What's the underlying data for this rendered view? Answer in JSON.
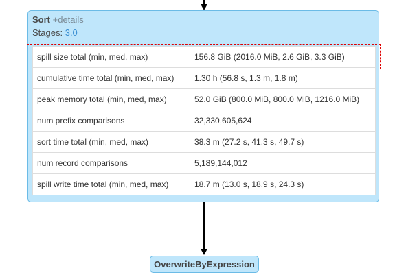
{
  "sort_node": {
    "title": "Sort",
    "details_link": "+details",
    "stages_label": "Stages:",
    "stages_value": "3.0",
    "metrics": [
      {
        "name": "spill size total (min, med, max)",
        "value": "156.8 GiB (2016.0 MiB, 2.6 GiB, 3.3 GiB)"
      },
      {
        "name": "cumulative time total (min, med, max)",
        "value": "1.30 h (56.8 s, 1.3 m, 1.8 m)"
      },
      {
        "name": "peak memory total (min, med, max)",
        "value": "52.0 GiB (800.0 MiB, 800.0 MiB, 1216.0 MiB)"
      },
      {
        "name": "num prefix comparisons",
        "value": "32,330,605,624"
      },
      {
        "name": "sort time total (min, med, max)",
        "value": "38.3 m (27.2 s, 41.3 s, 49.7 s)"
      },
      {
        "name": "num record comparisons",
        "value": "5,189,144,012"
      },
      {
        "name": "spill write time total (min, med, max)",
        "value": "18.7 m (13.0 s, 18.9 s, 24.3 s)"
      }
    ]
  },
  "child_node": {
    "title": "OverwriteByExpression"
  },
  "colors": {
    "node_fill": "#bfe6fb",
    "node_border": "#6bbbe6",
    "highlight": "#e00000",
    "link": "#3b8fd2"
  }
}
